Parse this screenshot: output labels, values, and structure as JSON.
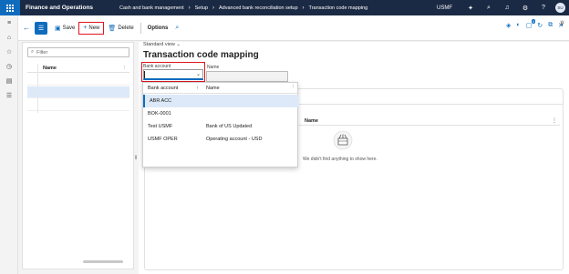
{
  "app": {
    "title": "Finance and Operations",
    "company": "USMF",
    "user_initials": "SU"
  },
  "breadcrumbs": [
    "Cash and bank management",
    "Setup",
    "Advanced bank reconciliation setup",
    "Transaction code mapping"
  ],
  "actions": {
    "save": "Save",
    "new": "New",
    "delete": "Delete",
    "options": "Options",
    "notification_count": "0"
  },
  "list": {
    "filter_placeholder": "Filter",
    "column_name": "Name"
  },
  "view": {
    "label": "Standard view",
    "page_title": "Transaction code mapping"
  },
  "form": {
    "bank_account_label": "Bank account",
    "bank_account_value": "",
    "name_label": "Name"
  },
  "lines": {
    "column_name": "Name",
    "empty_message": "We didn't find anything to show here."
  },
  "lookup": {
    "col_bank_account": "Bank account",
    "col_name": "Name",
    "rows": [
      {
        "account": "ABR ACC",
        "name": ""
      },
      {
        "account": "BOK-0001",
        "name": ""
      },
      {
        "account": "Test USMF",
        "name": "Bank of US Updated"
      },
      {
        "account": "USMF OPER",
        "name": "Operating account - USD"
      }
    ]
  },
  "colors": {
    "accent": "#0f6cbd",
    "nav_bg": "#1b2a44",
    "highlight": "#e0151e",
    "selected_row": "#dde9f8"
  }
}
